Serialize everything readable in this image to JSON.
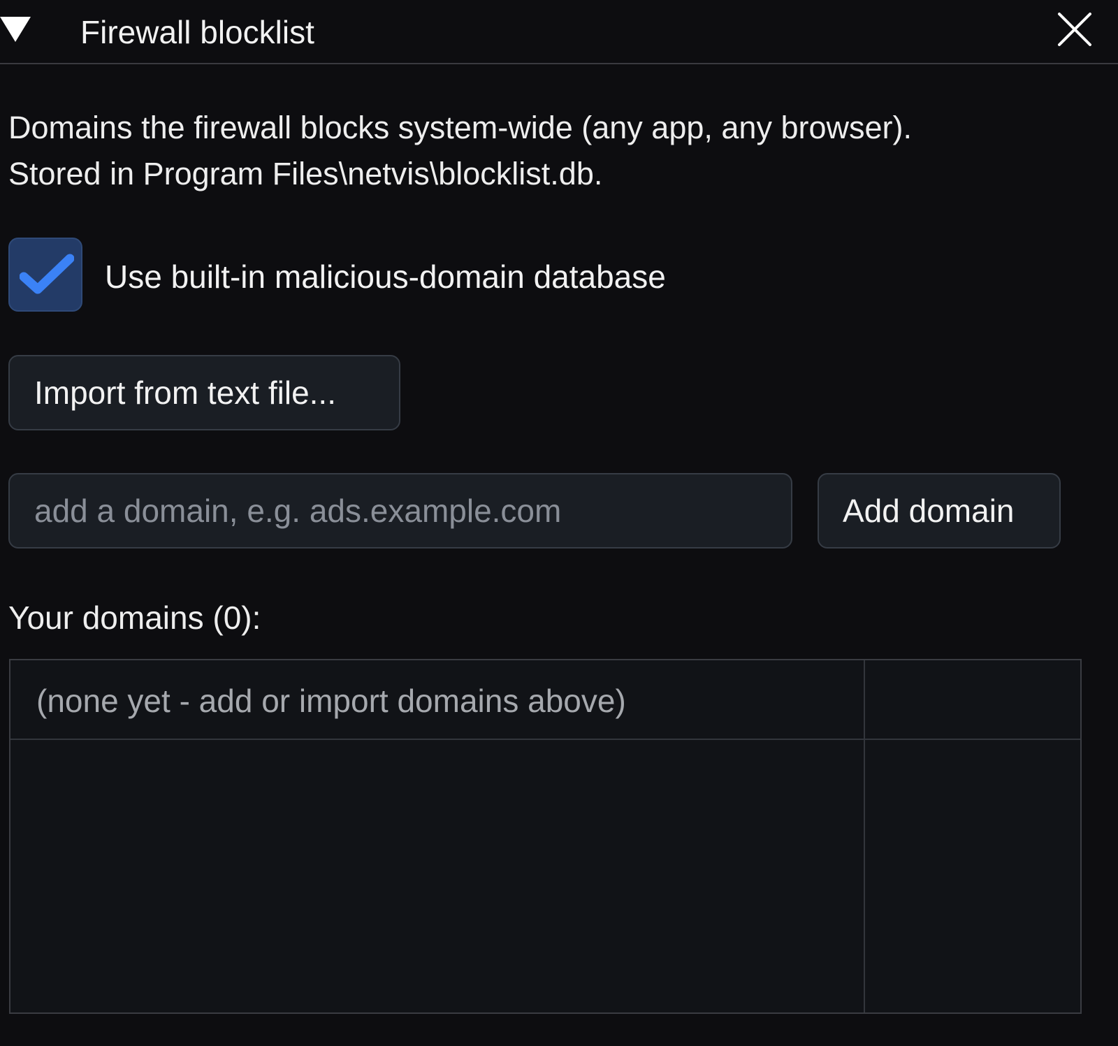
{
  "panel": {
    "title": "Firewall blocklist",
    "collapse_icon": "triangle-down-icon",
    "close_icon": "close-icon"
  },
  "description": {
    "line1": "Domains the firewall blocks system-wide (any app, any browser).",
    "line2": "Stored in Program Files\\netvis\\blocklist.db."
  },
  "builtin_db": {
    "label": "Use built-in malicious-domain database",
    "checked": true,
    "accent_color": "#3b82f6"
  },
  "import_button": {
    "label": "Import from text file..."
  },
  "add_domain": {
    "input_value": "",
    "placeholder": "add a domain, e.g. ads.example.com",
    "button_label": "Add domain"
  },
  "domain_list": {
    "heading": "Your domains (0):",
    "empty_text": "(none yet - add or import domains above)"
  }
}
